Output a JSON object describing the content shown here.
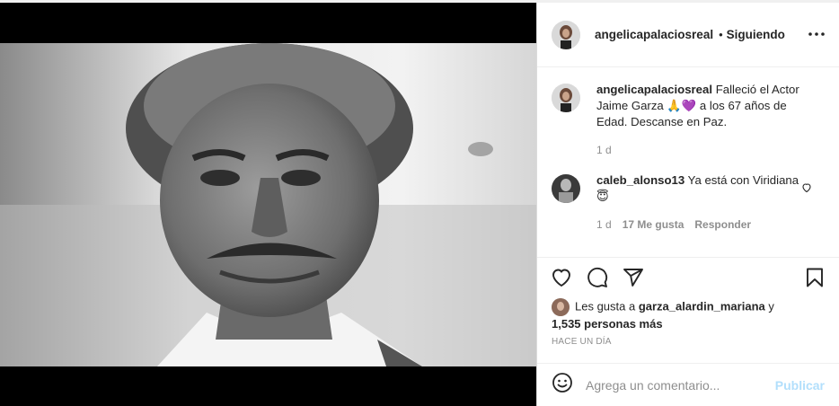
{
  "post": {
    "author": "angelicapalaciosreal",
    "separator": "•",
    "follow_status": "Siguiendo"
  },
  "caption": {
    "username": "angelicapalaciosreal",
    "text": " Falleció el Actor Jaime Garza 🙏💜 a los 67 años de Edad. Descanse en Paz.",
    "time": "1 d"
  },
  "comment": {
    "username": "caleb_alonso13",
    "text": " Ya está con Viridiana 😇",
    "time": "1 d",
    "likes": "17 Me gusta",
    "reply": "Responder"
  },
  "likes": {
    "prefix": "Les gusta a ",
    "user": "garza_alardin_mariana",
    "middle": " y ",
    "count": "1,535 personas más"
  },
  "timestamp": "HACE UN DÍA",
  "add_comment": {
    "placeholder": "Agrega un comentario...",
    "publish": "Publicar"
  },
  "icons": {
    "more": "more-options-icon",
    "like": "heart-icon",
    "comment": "comment-icon",
    "share": "paper-plane-icon",
    "save": "bookmark-icon",
    "emoji": "emoji-icon"
  },
  "colors": {
    "text": "#262626",
    "muted": "#8e8e8e",
    "publish_disabled": "#b2dffc",
    "border": "#efefef"
  }
}
